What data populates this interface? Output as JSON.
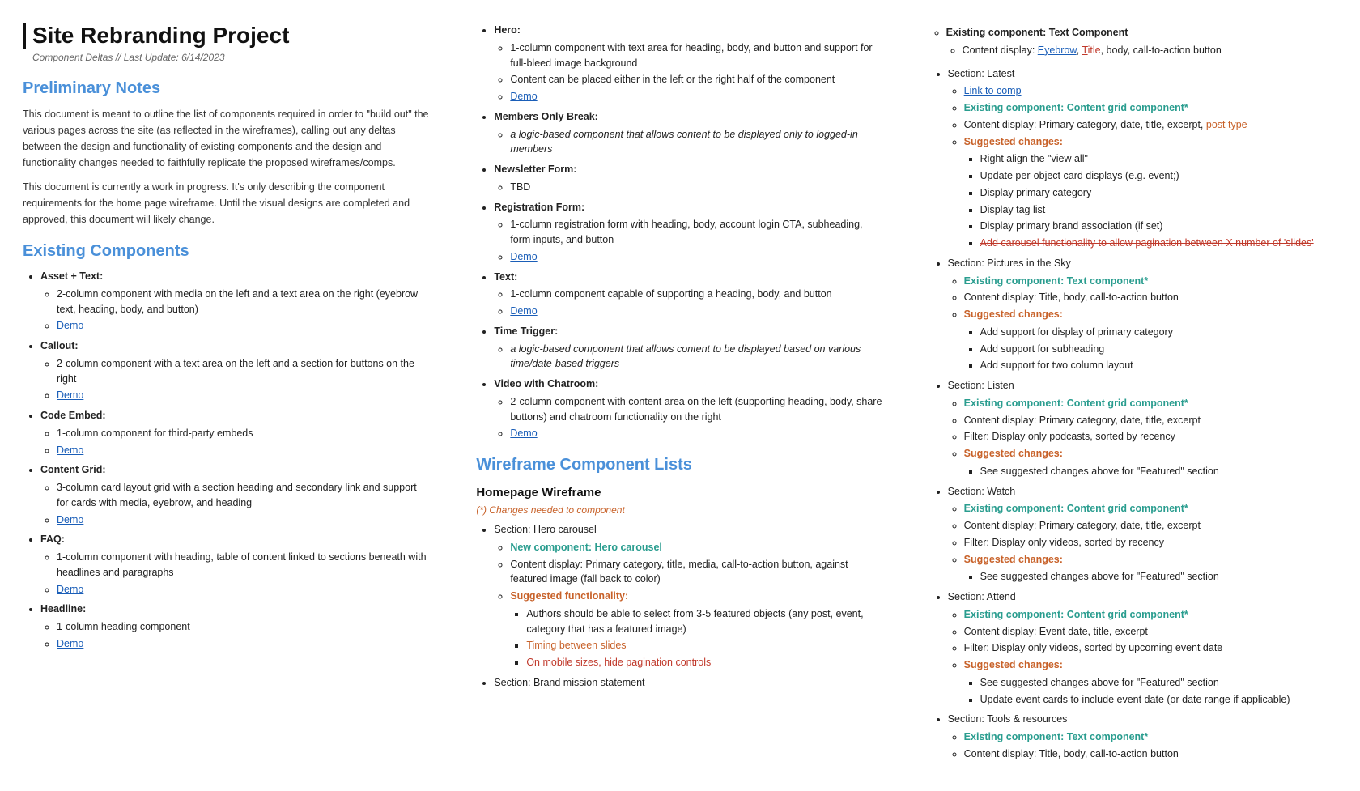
{
  "col1": {
    "title": "Site Rebranding Project",
    "subtitle": "Component Deltas // Last Update: 6/14/2023",
    "prelim_heading": "Preliminary Notes",
    "prelim_p1": "This document is meant to outline the list of components required in order to \"build out\" the various pages across the site (as reflected in the wireframes), calling out any deltas between the design and functionality of existing components and the design and functionality changes needed to faithfully replicate the proposed wireframes/comps.",
    "prelim_p2": "This document is currently a work in progress. It's only describing the component requirements for the home page wireframe. Until the visual designs are completed and approved, this document will likely change.",
    "existing_heading": "Existing Components",
    "components": [
      {
        "name": "Asset + Text:",
        "desc": "2-column component with media on the left and a text area on the right (eyebrow text, heading, body, and button)",
        "demo": "Demo"
      },
      {
        "name": "Callout:",
        "desc": "2-column component with a text area on the left and a section for buttons on the right",
        "demo": "Demo"
      },
      {
        "name": "Code Embed:",
        "desc": "1-column component for third-party embeds",
        "demo": "Demo"
      },
      {
        "name": "Content Grid:",
        "desc": "3-column card layout grid with a section heading and secondary link and support for cards with media, eyebrow, and heading",
        "demo": "Demo"
      },
      {
        "name": "FAQ:",
        "desc": "1-column component with heading, table of content linked to sections beneath with headlines and paragraphs",
        "demo": "Demo"
      },
      {
        "name": "Headline:",
        "desc": "1-column heading component",
        "demo": "Demo"
      }
    ]
  },
  "col2": {
    "items": [
      {
        "name": "Hero:",
        "subs": [
          "1-column component with text area for heading, body, and button and support for full-bleed image background",
          "Content can be placed either in the left or the right half of the component",
          "Demo"
        ]
      },
      {
        "name": "Members Only Break:",
        "subs": [
          "a logic-based component that allows content to be displayed only to logged-in members"
        ]
      },
      {
        "name": "Newsletter Form:",
        "subs": [
          "TBD"
        ]
      },
      {
        "name": "Registration Form:",
        "subs": [
          "1-column registration form with heading, body, account login CTA, subheading, form inputs, and button",
          "Demo"
        ]
      },
      {
        "name": "Text:",
        "subs": [
          "1-column component capable of supporting a heading, body, and button",
          "Demo"
        ]
      },
      {
        "name": "Time Trigger:",
        "subs": [
          "a logic-based component that allows content to be displayed based on various time/date-based triggers"
        ]
      },
      {
        "name": "Video with Chatroom:",
        "subs": [
          "2-column component with content area on the left (supporting heading, body, share buttons) and chatroom functionality on the right",
          "Demo"
        ]
      }
    ],
    "wireframe_heading": "Wireframe Component Lists",
    "homepage_heading": "Homepage Wireframe",
    "changes_note": "(*) Changes needed to component",
    "sections": [
      {
        "label": "Section: Hero carousel",
        "new_component": "New component: Hero carousel",
        "content_display": "Content display: Primary category, title, media, call-to-action button, against featured image (fall back to color)",
        "suggested_func": "Suggested functionality:",
        "func_items": [
          "Authors should be able to select from 3-5 featured objects (any post, event, category that has a featured image)",
          "Timing between slides",
          "On mobile sizes, hide pagination controls"
        ],
        "func_highlights": [
          1,
          2
        ]
      },
      {
        "label": "Section: Brand mission statement"
      }
    ]
  },
  "col3": {
    "sections": [
      {
        "prefix": "Existing component: Text Component",
        "content": "Content display: Eyebrow, Title, body, call-to-action button",
        "eyebrow_highlight": "Eyebrow",
        "title_highlight": "Title"
      },
      {
        "section_label": "Section: Latest",
        "link": "Link to comp",
        "existing": "Existing component: Content grid component*",
        "content": "Content display: Primary category, date, title, excerpt, post type",
        "post_type_highlight": "post type",
        "suggested_label": "Suggested changes:",
        "changes": [
          "Right align the \"view all\"",
          "Update per-object card displays (e.g. event;)",
          "Display primary category",
          "Display tag list",
          "Display primary brand association (if set)",
          "Add carousel functionality to allow pagination between X number of 'slides'"
        ],
        "last_change_strike": true
      },
      {
        "section_label": "Section: Pictures in the Sky",
        "existing": "Existing component: Text component*",
        "content": "Content display: Title, body, call-to-action button",
        "suggested_label": "Suggested changes:",
        "changes": [
          "Add support for display of primary category",
          "Add support for subheading",
          "Add support for two column layout"
        ]
      },
      {
        "section_label": "Section: Listen",
        "existing": "Existing component: Content grid component*",
        "content": "Content display: Primary category, date, title, excerpt",
        "filter": "Filter: Display only podcasts, sorted by recency",
        "suggested_label": "Suggested changes:",
        "changes": [
          "See suggested changes above for \"Featured\" section"
        ]
      },
      {
        "section_label": "Section: Watch",
        "existing": "Existing component: Content grid component*",
        "content": "Content display: Primary category, date, title, excerpt",
        "filter": "Filter: Display only videos, sorted by recency",
        "suggested_label": "Suggested changes:",
        "changes": [
          "See suggested changes above for \"Featured\" section"
        ]
      },
      {
        "section_label": "Section: Attend",
        "existing": "Existing component: Content grid component*",
        "content": "Content display: Event date, title, excerpt",
        "filter": "Filter: Display only videos, sorted by upcoming event date",
        "suggested_label": "Suggested changes:",
        "changes": [
          "See suggested changes above for \"Featured\" section",
          "Update event cards to include event date (or date range if applicable)"
        ]
      },
      {
        "section_label": "Section: Tools & resources",
        "existing": "Existing component: Text component*",
        "content": "Content display: Title, body, call-to-action button"
      }
    ]
  }
}
